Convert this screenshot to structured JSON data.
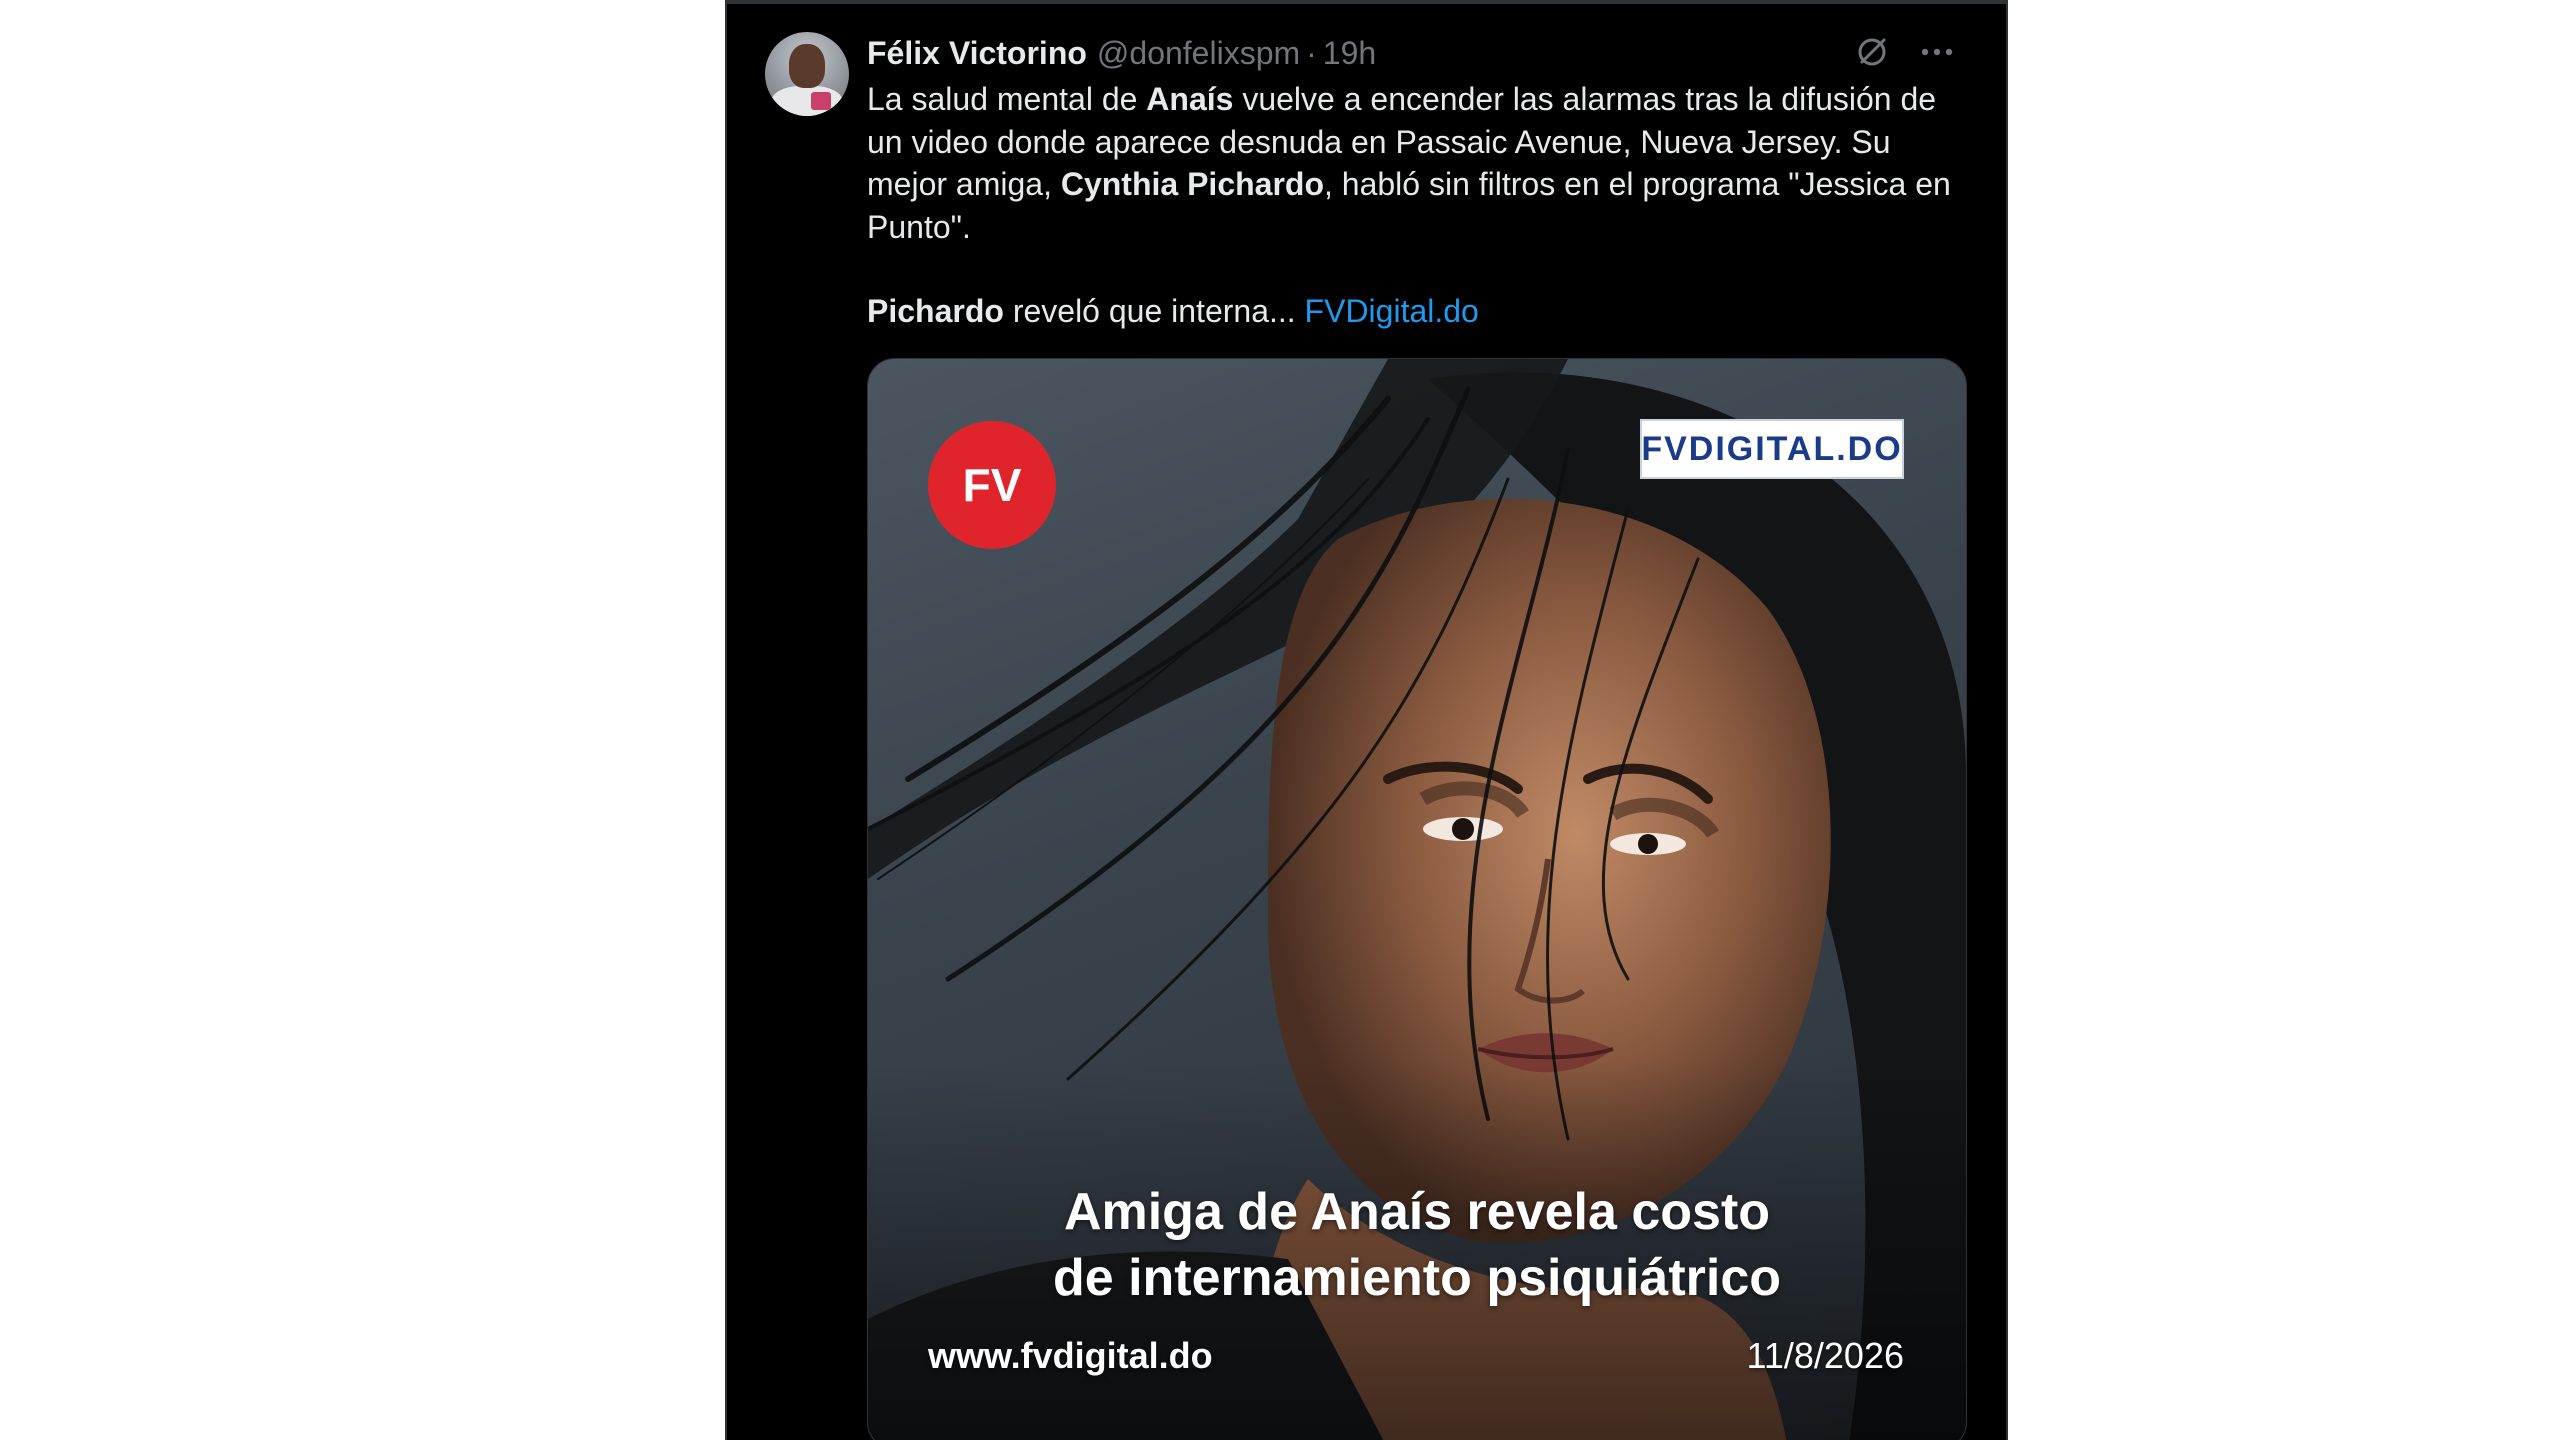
{
  "tweet": {
    "display_name": "Félix Victorino",
    "handle": "@donfelixspm",
    "separator": "·",
    "time": "19h",
    "avatar_icon": "user-avatar",
    "text": {
      "p1_a": "La salud mental de ",
      "p1_b": "Anaís",
      "p1_c": " vuelve a encender las alarmas tras la difusión de un video donde aparece desnuda en Passaic Avenue, Nueva Jersey. Su mejor amiga, ",
      "p1_d": "Cynthia Pichardo",
      "p1_e": ", habló sin filtros en el programa \"Jessica en Punto\".",
      "p2_a": "Pichardo",
      "p2_b": " reveló que interna... ",
      "p2_link": "FVDigital.do"
    },
    "actions": {
      "grok_icon": "grok-icon",
      "more_icon": "more-options-icon"
    }
  },
  "media": {
    "badge_text": "FV",
    "brand_text": "FVDIGITAL.DO",
    "headline_line1": "Amiga de Anaís revela costo",
    "headline_line2": "de internamiento psiquiátrico",
    "site_url": "www.fvdigital.do",
    "date": "11/8/2026"
  },
  "colors": {
    "background": "#000000",
    "text_primary": "#e7e9ea",
    "text_secondary": "#71767b",
    "link": "#1d9bf0",
    "badge_red": "#e0242c",
    "brand_blue": "#1a3a8a"
  }
}
